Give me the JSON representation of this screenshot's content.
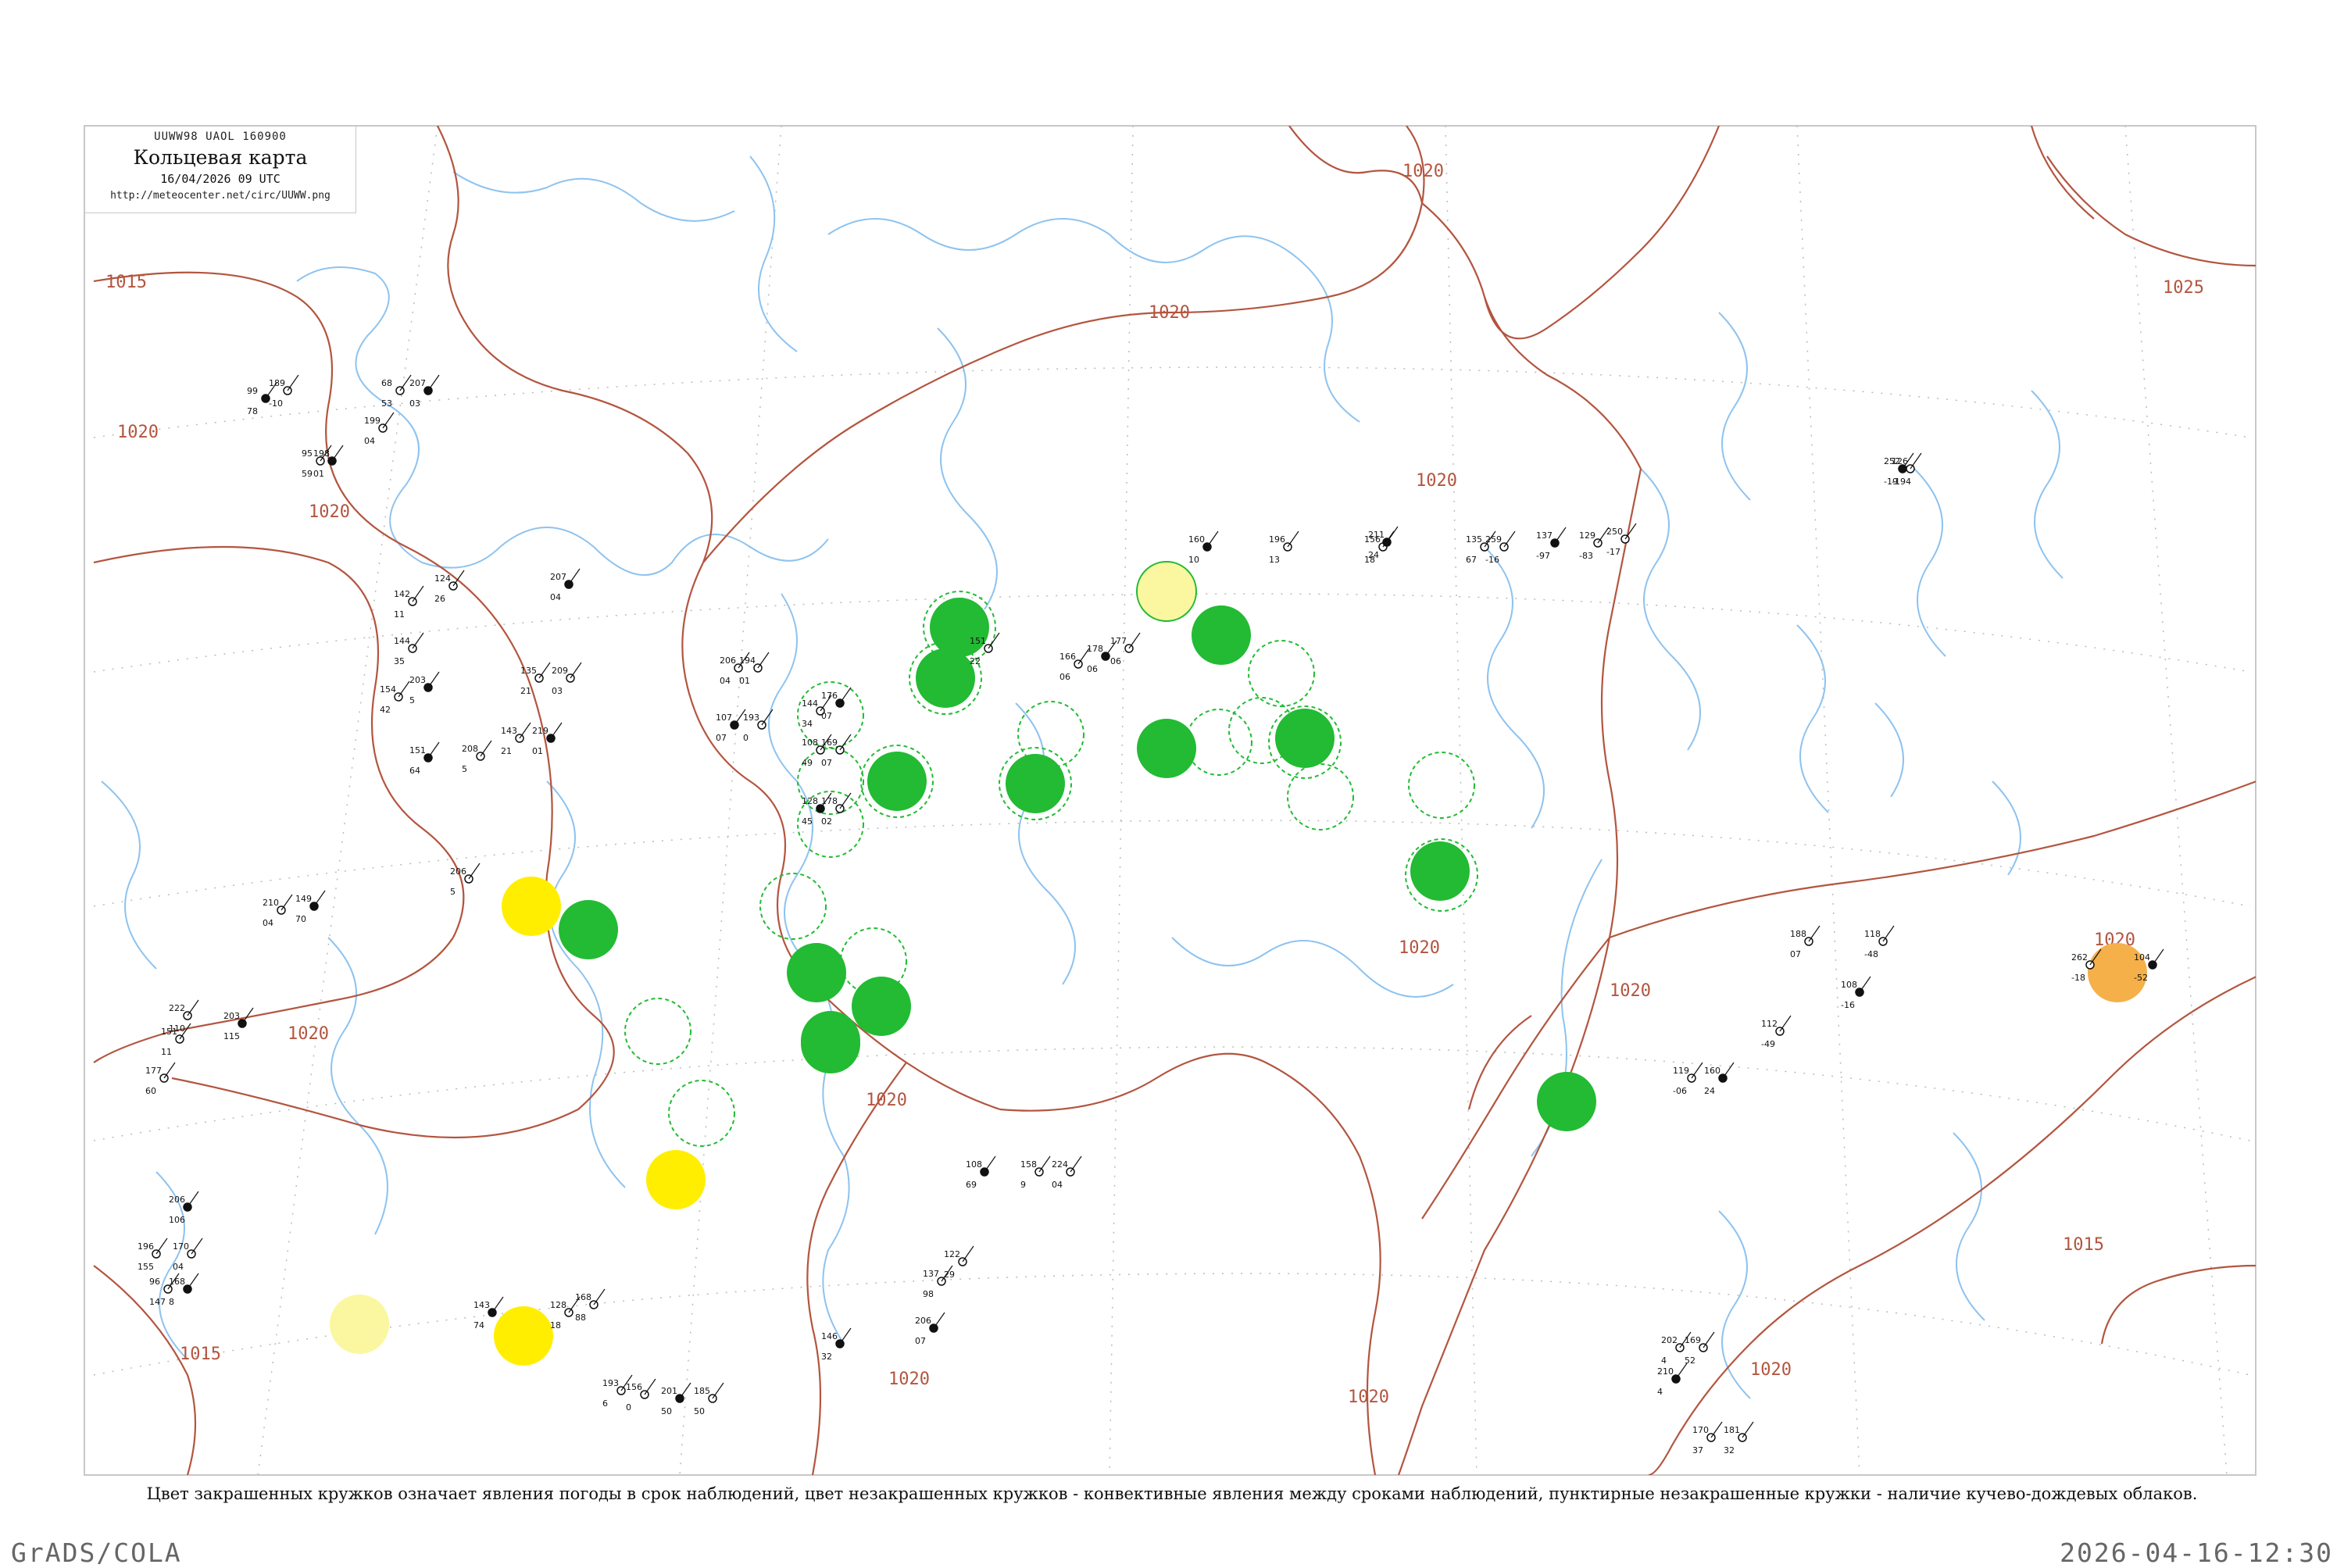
{
  "header": {
    "code": "UUWW98  UAOL  160900",
    "title": "Кольцевая карта",
    "datetime": "16/04/2026 09 UTC",
    "url": "http://meteocenter.net/circ/UUWW.png"
  },
  "caption": "Цвет закрашенных кружков означает явления погоды в срок наблюдений, цвет незакрашенных кружков - конвективные явления между сроками наблюдений, пунктирные незакрашенные кружки - наличие кучево-дождевых облаков.",
  "footer": {
    "left": "GrADS/COLA",
    "right": "2026-04-16-12:30"
  },
  "colors": {
    "isobar": "#b3553f",
    "water": "#8ec3ef",
    "grid": "#bbbbbb",
    "rain_fill": "#22bb33",
    "rain_dashed": "#22bb33",
    "snow_fill": "#ffee00",
    "snow_light": "#fbf7a0",
    "fog_fill": "#f5b04a"
  },
  "isobar_labels": [
    {
      "id": "l1",
      "text": "1015"
    },
    {
      "id": "l2",
      "text": "1020"
    },
    {
      "id": "l3",
      "text": "1020"
    },
    {
      "id": "l4",
      "text": "1020"
    },
    {
      "id": "l5",
      "text": "1020"
    },
    {
      "id": "l6",
      "text": "1020"
    },
    {
      "id": "l7",
      "text": "1025"
    },
    {
      "id": "l8",
      "text": "1020"
    },
    {
      "id": "l9",
      "text": "1020"
    },
    {
      "id": "l10",
      "text": "1020"
    },
    {
      "id": "l11",
      "text": "1015"
    },
    {
      "id": "l12",
      "text": "1020"
    },
    {
      "id": "l13",
      "text": "1020"
    },
    {
      "id": "l14",
      "text": "1020"
    },
    {
      "id": "l15",
      "text": "1015"
    },
    {
      "id": "l16",
      "text": "1020"
    },
    {
      "id": "l17",
      "text": "1020"
    }
  ],
  "stations": [
    {
      "p": "99",
      "t": "78",
      "id": ""
    },
    {
      "p": "189",
      "t": "-10",
      "id": ""
    },
    {
      "p": "68",
      "t": "53",
      "id": ""
    },
    {
      "p": "207",
      "t": "03",
      "id": ""
    },
    {
      "p": "199",
      "t": "04",
      "id": ""
    },
    {
      "p": "95",
      "t": "59",
      "id": ""
    },
    {
      "p": "198",
      "t": "01",
      "id": ""
    },
    {
      "p": "142",
      "t": "11",
      "id": ""
    },
    {
      "p": "124",
      "t": "26",
      "id": ""
    },
    {
      "p": "207",
      "t": "04",
      "id": ""
    },
    {
      "p": "144",
      "t": "35",
      "id": ""
    },
    {
      "p": "154",
      "t": "42",
      "id": ""
    },
    {
      "p": "203",
      "t": "5",
      "id": ""
    },
    {
      "p": "135",
      "t": "21",
      "id": ""
    },
    {
      "p": "209",
      "t": "03",
      "id": ""
    },
    {
      "p": "151",
      "t": "64",
      "id": ""
    },
    {
      "p": "208",
      "t": "5",
      "id": ""
    },
    {
      "p": "143",
      "t": "21",
      "id": ""
    },
    {
      "p": "219",
      "t": "01",
      "id": ""
    },
    {
      "p": "206",
      "t": "04",
      "id": ""
    },
    {
      "p": "194",
      "t": "01",
      "id": ""
    },
    {
      "p": "107",
      "t": "07",
      "id": ""
    },
    {
      "p": "193",
      "t": "0",
      "id": ""
    },
    {
      "p": "144",
      "t": "34",
      "id": ""
    },
    {
      "p": "176",
      "t": "07",
      "id": ""
    },
    {
      "p": "108",
      "t": "49",
      "id": ""
    },
    {
      "p": "169",
      "t": "07",
      "id": ""
    },
    {
      "p": "128",
      "t": "45",
      "id": ""
    },
    {
      "p": "178",
      "t": "02",
      "id": ""
    },
    {
      "p": "151",
      "t": "22",
      "id": ""
    },
    {
      "p": "178",
      "t": "06",
      "id": ""
    },
    {
      "p": "166",
      "t": "06",
      "id": ""
    },
    {
      "p": "177",
      "t": "06",
      "id": ""
    },
    {
      "p": "160",
      "t": "10",
      "id": ""
    },
    {
      "p": "196",
      "t": "13",
      "id": ""
    },
    {
      "p": "156",
      "t": "18",
      "id": ""
    },
    {
      "p": "211",
      "t": "24",
      "id": ""
    },
    {
      "p": "135",
      "t": "67",
      "id": ""
    },
    {
      "p": "259",
      "t": "-16",
      "id": ""
    },
    {
      "p": "137",
      "t": "-97",
      "id": ""
    },
    {
      "p": "250",
      "t": "-17",
      "id": ""
    },
    {
      "p": "129",
      "t": "-83",
      "id": ""
    },
    {
      "p": "252",
      "t": "-19",
      "id": ""
    },
    {
      "p": "126",
      "t": "-194",
      "id": ""
    },
    {
      "p": "262",
      "t": "-18",
      "id": ""
    },
    {
      "p": "104",
      "t": "-52",
      "id": ""
    },
    {
      "p": "188",
      "t": "07",
      "id": ""
    },
    {
      "p": "118",
      "t": "-48",
      "id": ""
    },
    {
      "p": "108",
      "t": "-16",
      "id": ""
    },
    {
      "p": "112",
      "t": "-49",
      "id": ""
    },
    {
      "p": "119",
      "t": "-06",
      "id": ""
    },
    {
      "p": "160",
      "t": "24",
      "id": ""
    },
    {
      "p": "202",
      "t": "4",
      "id": ""
    },
    {
      "p": "169",
      "t": "52",
      "id": ""
    },
    {
      "p": "210",
      "t": "4",
      "id": ""
    },
    {
      "p": "170",
      "t": "37",
      "id": ""
    },
    {
      "p": "181",
      "t": "32",
      "id": ""
    },
    {
      "p": "206",
      "t": "07",
      "id": ""
    },
    {
      "p": "137",
      "t": "98",
      "id": ""
    },
    {
      "p": "122",
      "t": "29",
      "id": ""
    },
    {
      "p": "108",
      "t": "69",
      "id": ""
    },
    {
      "p": "158",
      "t": "9",
      "id": ""
    },
    {
      "p": "224",
      "t": "04",
      "id": ""
    },
    {
      "p": "146",
      "t": "32",
      "id": ""
    },
    {
      "p": "128",
      "t": "18",
      "id": ""
    },
    {
      "p": "168",
      "t": "88",
      "id": ""
    },
    {
      "p": "143",
      "t": "74",
      "id": ""
    },
    {
      "p": "193",
      "t": "6",
      "id": ""
    },
    {
      "p": "156",
      "t": "0",
      "id": ""
    },
    {
      "p": "201",
      "t": "50",
      "id": ""
    },
    {
      "p": "185",
      "t": "50",
      "id": ""
    },
    {
      "p": "96",
      "t": "147",
      "id": ""
    },
    {
      "p": "168",
      "t": "8",
      "id": ""
    },
    {
      "p": "196",
      "t": "155",
      "id": ""
    },
    {
      "p": "170",
      "t": "04",
      "id": ""
    },
    {
      "p": "206",
      "t": "106",
      "id": ""
    },
    {
      "p": "222",
      "t": "110",
      "id": ""
    },
    {
      "p": "151",
      "t": "11",
      "id": ""
    },
    {
      "p": "203",
      "t": "115",
      "id": ""
    },
    {
      "p": "177",
      "t": "60",
      "id": ""
    },
    {
      "p": "210",
      "t": "04",
      "id": ""
    },
    {
      "p": "149",
      "t": "70",
      "id": ""
    },
    {
      "p": "206",
      "t": "5",
      "id": ""
    }
  ]
}
